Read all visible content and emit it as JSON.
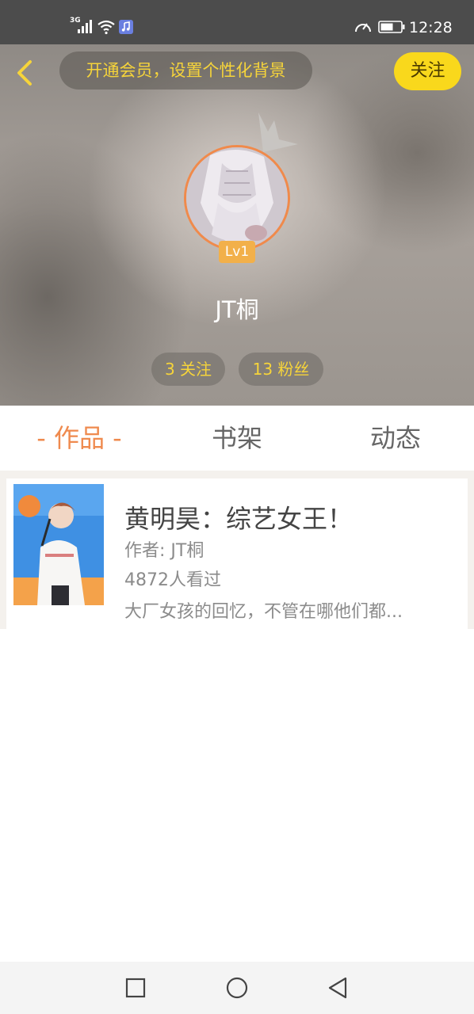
{
  "status_bar": {
    "network": "3G",
    "time": "12:28",
    "icons": [
      "signal-icon",
      "wifi-icon",
      "music-app-icon",
      "speed-icon",
      "battery-icon"
    ]
  },
  "header": {
    "back_icon": "chevron-left-icon",
    "banner_text": "开通会员，设置个性化背景",
    "follow_label": "关注",
    "level_badge": "Lv1",
    "username": "JT桐",
    "following_text": "3 关注",
    "fans_text": "13 粉丝"
  },
  "tabs": [
    {
      "label": "- 作品 -",
      "active": true
    },
    {
      "label": "书架",
      "active": false
    },
    {
      "label": "动态",
      "active": false
    }
  ],
  "works": [
    {
      "title": "黄明昊：综艺女王！",
      "author": "作者: JT桐",
      "views": "4872人看过",
      "description": "大厂女孩的回忆，不管在哪他们都..."
    }
  ],
  "nav_bar": {
    "icons": [
      "recent-apps-icon",
      "home-icon",
      "back-icon"
    ]
  },
  "colors": {
    "accent_orange": "#ef8a4e",
    "accent_yellow": "#f9d81c",
    "banner_text": "#f6d43a",
    "status_bar_bg": "#4c4c4c"
  }
}
